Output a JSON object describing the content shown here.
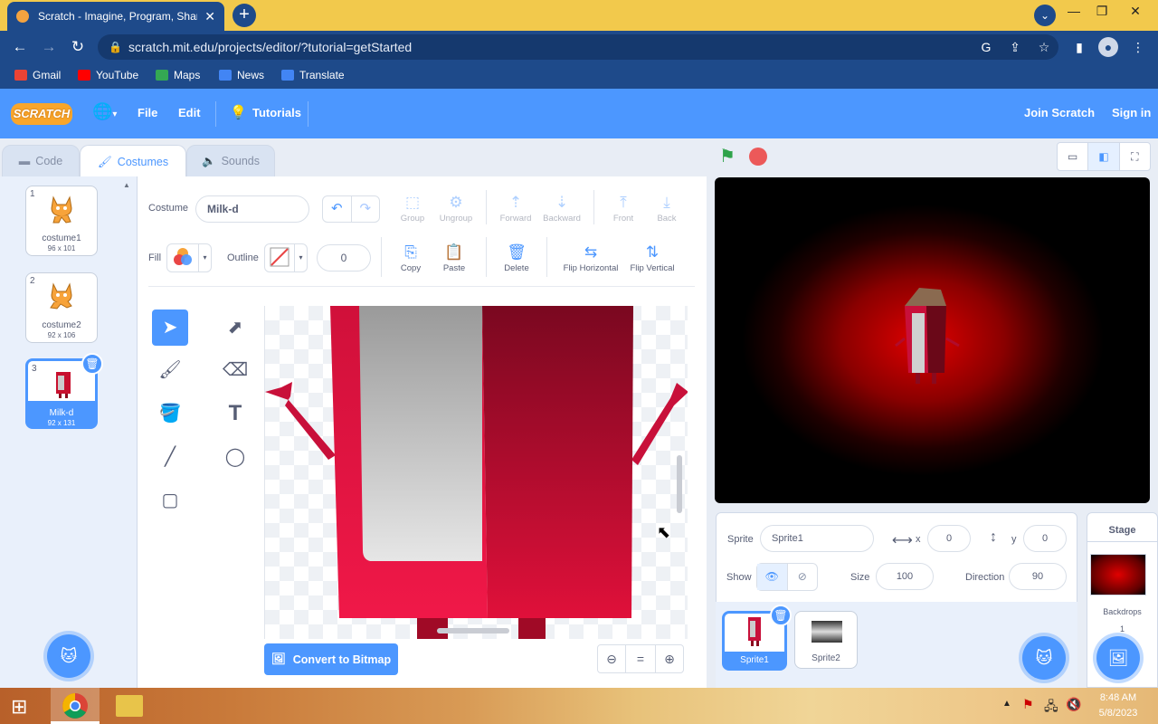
{
  "browser": {
    "tab_title": "Scratch - Imagine, Program, Share",
    "url": "scratch.mit.edu/projects/editor/?tutorial=getStarted",
    "bookmarks": [
      {
        "label": "Gmail",
        "color": "#ea4335"
      },
      {
        "label": "YouTube",
        "color": "#ff0000"
      },
      {
        "label": "Maps",
        "color": "#34a853"
      },
      {
        "label": "News",
        "color": "#4285f4"
      },
      {
        "label": "Translate",
        "color": "#4285f4"
      }
    ]
  },
  "menu": {
    "logo": "SCRATCH",
    "file": "File",
    "edit": "Edit",
    "tutorials": "Tutorials",
    "join": "Join Scratch",
    "signin": "Sign in"
  },
  "tabs": {
    "code": "Code",
    "costumes": "Costumes",
    "sounds": "Sounds"
  },
  "costumes": [
    {
      "num": "1",
      "name": "costume1",
      "size": "96 x 101"
    },
    {
      "num": "2",
      "name": "costume2",
      "size": "92 x 106"
    },
    {
      "num": "3",
      "name": "Milk-d",
      "size": "92 x 131"
    }
  ],
  "editor": {
    "costume_label": "Costume",
    "costume_name": "Milk-d",
    "fill_label": "Fill",
    "outline_label": "Outline",
    "outline_width": "0",
    "group": "Group",
    "ungroup": "Ungroup",
    "forward": "Forward",
    "backward": "Backward",
    "front": "Front",
    "back": "Back",
    "copy": "Copy",
    "paste": "Paste",
    "delete": "Delete",
    "flip_h": "Flip Horizontal",
    "flip_v": "Flip Vertical",
    "convert": "Convert to Bitmap",
    "zoom_reset": "="
  },
  "sprite": {
    "label": "Sprite",
    "name": "Sprite1",
    "x_label": "x",
    "x": "0",
    "y_label": "y",
    "y": "0",
    "show_label": "Show",
    "size_label": "Size",
    "size": "100",
    "direction_label": "Direction",
    "direction": "90"
  },
  "sprites": [
    {
      "name": "Sprite1"
    },
    {
      "name": "Sprite2"
    }
  ],
  "stage_panel": {
    "title": "Stage",
    "backdrops_label": "Backdrops",
    "backdrops_count": "1"
  },
  "taskbar": {
    "time": "8:48 AM",
    "date": "5/8/2023"
  },
  "colors": {
    "scratch_blue": "#4c97ff",
    "chrome_blue": "#1e4a8a",
    "tab_yellow": "#f2c94c",
    "milk_red": "#e0103a"
  }
}
